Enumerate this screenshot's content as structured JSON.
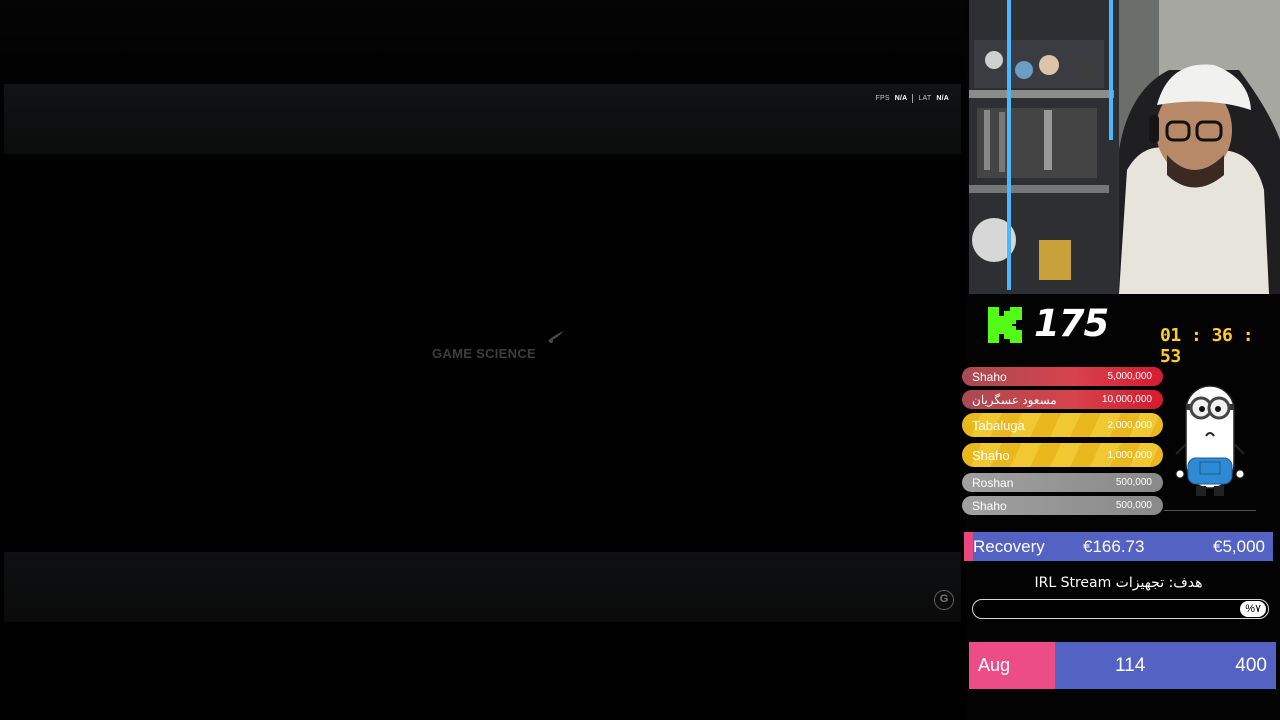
{
  "game": {
    "fps_label": "FPS",
    "fps_value": "N/A",
    "lat_label": "LAT",
    "lat_value": "N/A",
    "logo_text": "GAME SCIENCE",
    "corner_button": "G"
  },
  "kick": {
    "icon": "kick-logo-icon",
    "viewers": "175",
    "timer": "01 : 36 : 53",
    "brand_color": "#53fc18"
  },
  "donations": [
    {
      "name": "Shaho",
      "amount": "5,000,000",
      "style": "red"
    },
    {
      "name": "مسعود عسگریان",
      "amount": "10,000,000",
      "style": "red"
    },
    {
      "name": "Tabaluga",
      "amount": "2,000,000",
      "style": "gold"
    },
    {
      "name": "Shaho",
      "amount": "1,000,000",
      "style": "gold"
    },
    {
      "name": "Roshan",
      "amount": "500,000",
      "style": "grey"
    },
    {
      "name": "Shaho",
      "amount": "500,000",
      "style": "grey"
    }
  ],
  "recovery": {
    "label": "Recovery",
    "current": "€166.73",
    "target": "€5,000"
  },
  "goal": {
    "title": "هدف: تجهیزات IRL Stream",
    "percent": "%۷",
    "progress": 0.07
  },
  "monthly": {
    "month": "Aug",
    "current": "114",
    "target": "400"
  },
  "colors": {
    "accent_blue": "#5462c4",
    "accent_pink": "#ed4d87",
    "timer": "#ffcc2a"
  }
}
